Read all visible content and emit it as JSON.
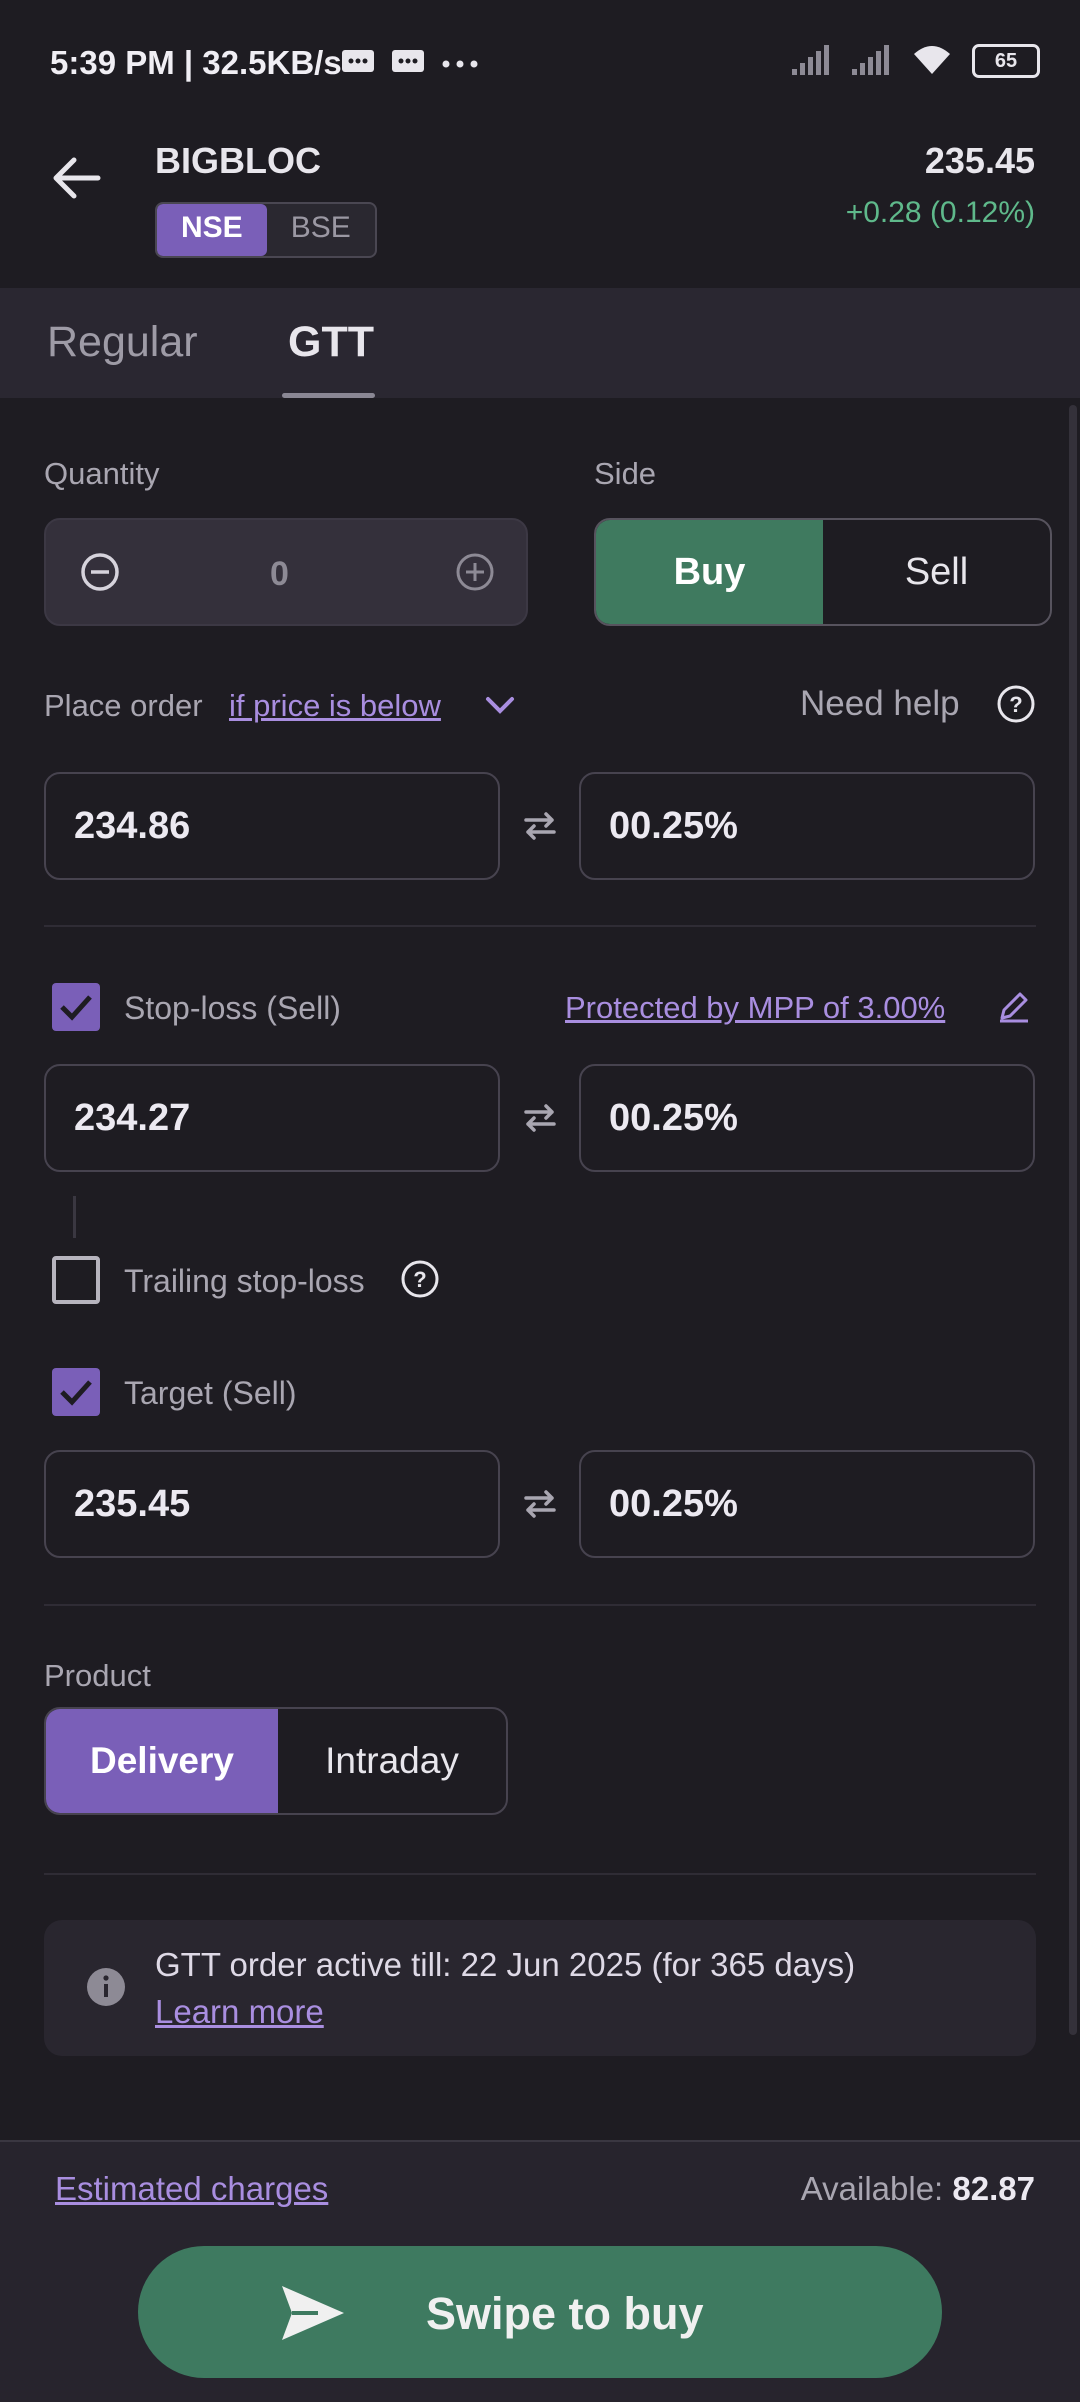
{
  "status_bar": {
    "time_speed": "5:39 PM | 32.5KB/s",
    "battery": "65"
  },
  "header": {
    "symbol": "BIGBLOC",
    "exchange_active": "NSE",
    "exchange_inactive": "BSE",
    "price": "235.45",
    "change": "+0.28 (0.12%)"
  },
  "tabs": {
    "regular": "Regular",
    "gtt": "GTT"
  },
  "quantity": {
    "label": "Quantity",
    "value": "0"
  },
  "side": {
    "label": "Side",
    "buy": "Buy",
    "sell": "Sell"
  },
  "trigger": {
    "prefix": "Place order",
    "condition": "if price is below",
    "help": "Need help",
    "price": "234.86",
    "percent": "00.25%"
  },
  "stoploss": {
    "label": "Stop-loss (Sell)",
    "mpp": "Protected by MPP of 3.00%",
    "price": "234.27",
    "percent": "00.25%",
    "trailing_label": "Trailing stop-loss"
  },
  "target": {
    "label": "Target (Sell)",
    "price": "235.45",
    "percent": "00.25%"
  },
  "product": {
    "label": "Product",
    "delivery": "Delivery",
    "intraday": "Intraday"
  },
  "info": {
    "text": "GTT order active till: 22 Jun 2025 (for 365 days)",
    "link": "Learn more"
  },
  "footer": {
    "estimated": "Estimated charges",
    "available_label": "Available:",
    "available_value": "82.87",
    "swipe": "Swipe to buy"
  },
  "colors": {
    "accent": "#7a5fb8",
    "buy": "#3f7a5f",
    "positive": "#5fb98b"
  }
}
